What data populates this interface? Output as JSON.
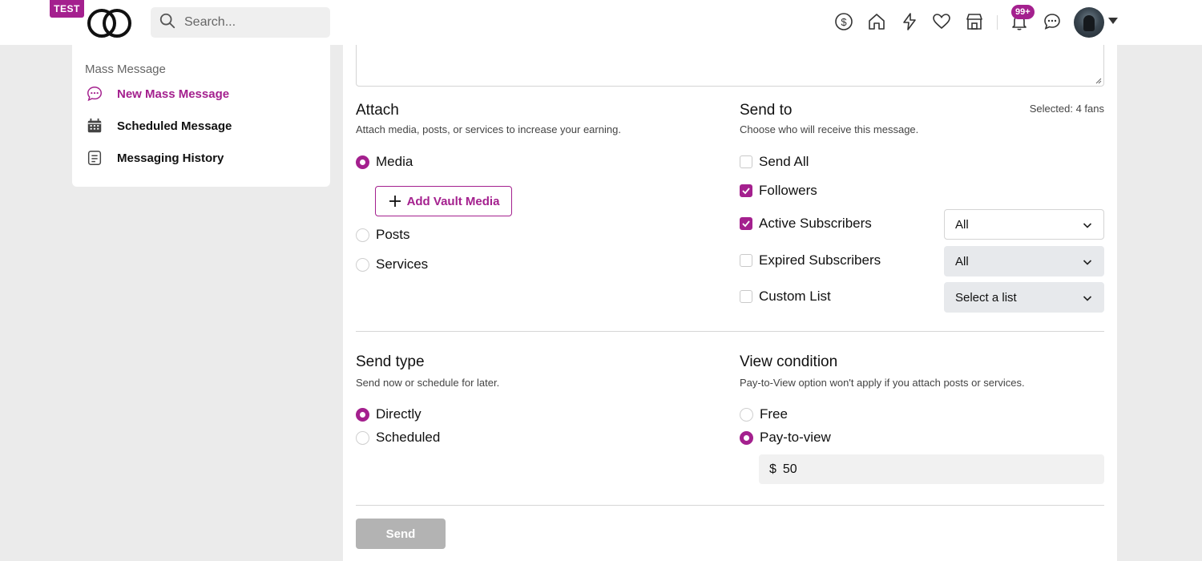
{
  "header": {
    "test_badge": "TEST",
    "search_placeholder": "Search...",
    "notification_count": "99+"
  },
  "colors": {
    "accent": "#a4208e",
    "background": "#ebebeb"
  },
  "sidebar": {
    "title": "Mass Message",
    "items": [
      {
        "label": "New Mass Message",
        "icon": "chat-bubble-icon",
        "active": true
      },
      {
        "label": "Scheduled Message",
        "icon": "calendar-icon",
        "active": false
      },
      {
        "label": "Messaging History",
        "icon": "document-list-icon",
        "active": false
      }
    ]
  },
  "attach": {
    "title": "Attach",
    "subtitle": "Attach media, posts, or services to increase your earning.",
    "options": [
      {
        "label": "Media",
        "selected": true
      },
      {
        "label": "Posts",
        "selected": false
      },
      {
        "label": "Services",
        "selected": false
      }
    ],
    "add_vault_label": "Add Vault Media"
  },
  "send_to": {
    "title": "Send to",
    "subtitle": "Choose who will receive this message.",
    "selected_count": "Selected: 4 fans",
    "options": [
      {
        "label": "Send All",
        "checked": false
      },
      {
        "label": "Followers",
        "checked": true
      },
      {
        "label": "Active Subscribers",
        "checked": true,
        "select_value": "All"
      },
      {
        "label": "Expired Subscribers",
        "checked": false,
        "select_value": "All"
      },
      {
        "label": "Custom List",
        "checked": false,
        "select_value": "Select a list"
      }
    ]
  },
  "send_type": {
    "title": "Send type",
    "subtitle": "Send now or schedule for later.",
    "options": [
      {
        "label": "Directly",
        "selected": true
      },
      {
        "label": "Scheduled",
        "selected": false
      }
    ]
  },
  "view_condition": {
    "title": "View condition",
    "subtitle": "Pay-to-View option won't apply if you attach posts or services.",
    "options": [
      {
        "label": "Free",
        "selected": false
      },
      {
        "label": "Pay-to-view",
        "selected": true
      }
    ],
    "currency": "$",
    "price": "50"
  },
  "footer": {
    "send_label": "Send"
  }
}
